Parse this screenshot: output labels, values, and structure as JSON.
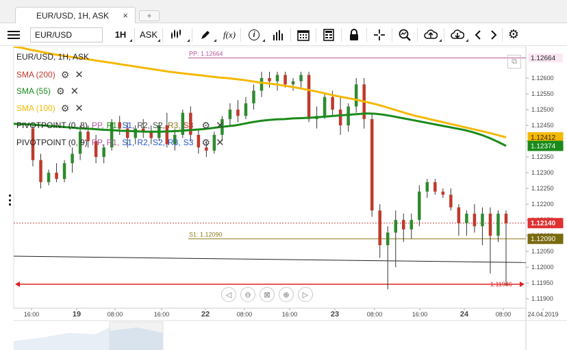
{
  "tab": {
    "label": "EUR/USD, 1H, ASK",
    "close": "×",
    "add": "+"
  },
  "toolbar": {
    "symbol": "EUR/USD",
    "timeframe": "1H",
    "side": "ASK",
    "fx_label": "f(x)",
    "info_label": "i",
    "icons": [
      "menu-icon",
      "candles-icon",
      "pencil-icon",
      "fx-icon",
      "info-icon",
      "bars-icon",
      "calendar-icon",
      "sheet-icon",
      "lock-icon",
      "crosshair-icon",
      "zoom-icon",
      "upload-icon",
      "download-icon",
      "prev-icon",
      "next-icon",
      "gear-icon"
    ]
  },
  "legend": {
    "title": "EUR/USD, 1H, ASK",
    "sma200": "SMA (200)",
    "sma55": "SMA (55)",
    "sma100": "SMA (100)",
    "pivot8": "PIVOTPOINT (0, 8)",
    "pivot9": "PIVOTPOINT (0, 9)",
    "pivot_parts": [
      "PP,",
      "R1,",
      "S1,",
      "R2,",
      "S2,",
      "R3,",
      "S3"
    ]
  },
  "levels": {
    "pp_label": "PP: 1.12664",
    "s1_label": "S1: 1.12090",
    "red_label": "1.11946"
  },
  "price_tags": {
    "pp": "1.12664",
    "sma100": "1.12412",
    "sma55": "1.12374",
    "current": "1.12140",
    "s1": "1.12090"
  },
  "yaxis": [
    "1.12600",
    "1.12550",
    "1.12500",
    "1.12450",
    "1.12400",
    "1.12350",
    "1.12300",
    "1.12250",
    "1.12200",
    "1.12150",
    "1.12100",
    "1.12050",
    "1.12000",
    "1.11950",
    "1.11900"
  ],
  "xaxis": [
    "16:00",
    "19",
    "08:00",
    "16:00",
    "22",
    "08:00",
    "16:00",
    "23",
    "08:00",
    "16:00",
    "24",
    "08:00",
    "24.04.2019"
  ],
  "colors": {
    "sma200": "#c0392b",
    "sma55": "#1a8a1a",
    "sma100": "#f5b800",
    "bull": "#2e8b2e",
    "bear": "#c0392b",
    "pp": "#b0559b",
    "s1": "#8a7a18",
    "red": "#e02020"
  },
  "chart_data": {
    "type": "candlestick",
    "title": "EUR/USD, 1H, ASK",
    "xlabel": "",
    "ylabel": "",
    "ylim": [
      1.1187,
      1.127
    ],
    "candles": [
      {
        "o": 1.1244,
        "h": 1.1246,
        "l": 1.1232,
        "c": 1.1234
      },
      {
        "o": 1.1234,
        "h": 1.1236,
        "l": 1.1225,
        "c": 1.1227
      },
      {
        "o": 1.1227,
        "h": 1.1231,
        "l": 1.1226,
        "c": 1.123
      },
      {
        "o": 1.123,
        "h": 1.1233,
        "l": 1.1227,
        "c": 1.1228
      },
      {
        "o": 1.1228,
        "h": 1.1234,
        "l": 1.1227,
        "c": 1.1233
      },
      {
        "o": 1.1233,
        "h": 1.1238,
        "l": 1.123,
        "c": 1.1236
      },
      {
        "o": 1.1236,
        "h": 1.1245,
        "l": 1.1234,
        "c": 1.1243
      },
      {
        "o": 1.1243,
        "h": 1.1245,
        "l": 1.1238,
        "c": 1.124
      },
      {
        "o": 1.124,
        "h": 1.1242,
        "l": 1.1233,
        "c": 1.1235
      },
      {
        "o": 1.1235,
        "h": 1.1239,
        "l": 1.1233,
        "c": 1.1238
      },
      {
        "o": 1.1238,
        "h": 1.1247,
        "l": 1.1237,
        "c": 1.1246
      },
      {
        "o": 1.1246,
        "h": 1.1248,
        "l": 1.1242,
        "c": 1.1244
      },
      {
        "o": 1.1244,
        "h": 1.1246,
        "l": 1.1238,
        "c": 1.1241
      },
      {
        "o": 1.1241,
        "h": 1.1245,
        "l": 1.1239,
        "c": 1.1244
      },
      {
        "o": 1.1244,
        "h": 1.1247,
        "l": 1.1241,
        "c": 1.1243
      },
      {
        "o": 1.1243,
        "h": 1.1245,
        "l": 1.1239,
        "c": 1.1241
      },
      {
        "o": 1.1241,
        "h": 1.1246,
        "l": 1.124,
        "c": 1.1245
      },
      {
        "o": 1.1245,
        "h": 1.1249,
        "l": 1.1238,
        "c": 1.1239
      },
      {
        "o": 1.1239,
        "h": 1.1244,
        "l": 1.1237,
        "c": 1.1242
      },
      {
        "o": 1.1242,
        "h": 1.125,
        "l": 1.1241,
        "c": 1.1249
      },
      {
        "o": 1.1249,
        "h": 1.1251,
        "l": 1.124,
        "c": 1.1242
      },
      {
        "o": 1.1242,
        "h": 1.1244,
        "l": 1.1236,
        "c": 1.1238
      },
      {
        "o": 1.1238,
        "h": 1.124,
        "l": 1.1235,
        "c": 1.1237
      },
      {
        "o": 1.1237,
        "h": 1.1243,
        "l": 1.1236,
        "c": 1.1242
      },
      {
        "o": 1.1242,
        "h": 1.1248,
        "l": 1.124,
        "c": 1.1247
      },
      {
        "o": 1.1247,
        "h": 1.1252,
        "l": 1.1245,
        "c": 1.125
      },
      {
        "o": 1.125,
        "h": 1.1253,
        "l": 1.1246,
        "c": 1.1248
      },
      {
        "o": 1.1248,
        "h": 1.1254,
        "l": 1.1247,
        "c": 1.1252
      },
      {
        "o": 1.1252,
        "h": 1.1258,
        "l": 1.125,
        "c": 1.1256
      },
      {
        "o": 1.1256,
        "h": 1.1262,
        "l": 1.1254,
        "c": 1.126
      },
      {
        "o": 1.126,
        "h": 1.1262,
        "l": 1.1257,
        "c": 1.1259
      },
      {
        "o": 1.1259,
        "h": 1.1262,
        "l": 1.1256,
        "c": 1.1261
      },
      {
        "o": 1.1261,
        "h": 1.1262,
        "l": 1.1257,
        "c": 1.1258
      },
      {
        "o": 1.1258,
        "h": 1.126,
        "l": 1.1256,
        "c": 1.1259
      },
      {
        "o": 1.1259,
        "h": 1.1262,
        "l": 1.1257,
        "c": 1.1261
      },
      {
        "o": 1.1261,
        "h": 1.1262,
        "l": 1.1246,
        "c": 1.1247
      },
      {
        "o": 1.1247,
        "h": 1.1251,
        "l": 1.1244,
        "c": 1.1248
      },
      {
        "o": 1.1248,
        "h": 1.1255,
        "l": 1.1247,
        "c": 1.1254
      },
      {
        "o": 1.1254,
        "h": 1.1256,
        "l": 1.1248,
        "c": 1.125
      },
      {
        "o": 1.125,
        "h": 1.1254,
        "l": 1.1242,
        "c": 1.1245
      },
      {
        "o": 1.1245,
        "h": 1.1252,
        "l": 1.1243,
        "c": 1.1251
      },
      {
        "o": 1.1251,
        "h": 1.126,
        "l": 1.1249,
        "c": 1.1258
      },
      {
        "o": 1.1258,
        "h": 1.126,
        "l": 1.1244,
        "c": 1.1247
      },
      {
        "o": 1.1247,
        "h": 1.1249,
        "l": 1.1216,
        "c": 1.1218
      },
      {
        "o": 1.1218,
        "h": 1.122,
        "l": 1.1203,
        "c": 1.1207
      },
      {
        "o": 1.1207,
        "h": 1.1213,
        "l": 1.1193,
        "c": 1.1211
      },
      {
        "o": 1.1211,
        "h": 1.1218,
        "l": 1.12,
        "c": 1.1215
      },
      {
        "o": 1.1215,
        "h": 1.1217,
        "l": 1.1208,
        "c": 1.1212
      },
      {
        "o": 1.1212,
        "h": 1.1217,
        "l": 1.1209,
        "c": 1.1215
      },
      {
        "o": 1.1215,
        "h": 1.1226,
        "l": 1.1213,
        "c": 1.1224
      },
      {
        "o": 1.1224,
        "h": 1.1228,
        "l": 1.1222,
        "c": 1.1227
      },
      {
        "o": 1.1227,
        "h": 1.1228,
        "l": 1.1223,
        "c": 1.1224
      },
      {
        "o": 1.1224,
        "h": 1.1225,
        "l": 1.1222,
        "c": 1.1223
      },
      {
        "o": 1.1223,
        "h": 1.1225,
        "l": 1.1218,
        "c": 1.1219
      },
      {
        "o": 1.1219,
        "h": 1.122,
        "l": 1.121,
        "c": 1.1214
      },
      {
        "o": 1.1214,
        "h": 1.1218,
        "l": 1.121,
        "c": 1.1217
      },
      {
        "o": 1.1217,
        "h": 1.122,
        "l": 1.1211,
        "c": 1.1213
      },
      {
        "o": 1.1213,
        "h": 1.1219,
        "l": 1.1207,
        "c": 1.1217
      },
      {
        "o": 1.1217,
        "h": 1.1219,
        "l": 1.1198,
        "c": 1.121
      },
      {
        "o": 1.121,
        "h": 1.1218,
        "l": 1.1208,
        "c": 1.1217
      },
      {
        "o": 1.1217,
        "h": 1.1218,
        "l": 1.1194,
        "c": 1.1214
      }
    ],
    "sma55": [
      1.12455,
      1.12454,
      1.12453,
      1.12451,
      1.12449,
      1.12447,
      1.12445,
      1.12443,
      1.12441,
      1.1244,
      1.12438,
      1.12436,
      1.12435,
      1.12433,
      1.12432,
      1.12431,
      1.1243,
      1.1243,
      1.1243,
      1.12431,
      1.12432,
      1.12434,
      1.12436,
      1.12438,
      1.12441,
      1.12444,
      1.12447,
      1.1245,
      1.12455,
      1.1246,
      1.12464,
      1.12467,
      1.12469,
      1.1247,
      1.12472,
      1.12473,
      1.12474,
      1.12476,
      1.12478,
      1.1248,
      1.12482,
      1.12484,
      1.12486,
      1.12488,
      1.12487,
      1.12484,
      1.1248,
      1.12475,
      1.1247,
      1.12465,
      1.1246,
      1.12455,
      1.1245,
      1.12445,
      1.1244,
      1.12435,
      1.12428,
      1.1242,
      1.1241,
      1.12398,
      1.12385
    ],
    "sma100": [
      1.127,
      1.12696,
      1.1269,
      1.12685,
      1.1268,
      1.12675,
      1.12671,
      1.12667,
      1.12664,
      1.1266,
      1.12656,
      1.12652,
      1.12648,
      1.12644,
      1.1264,
      1.12636,
      1.12632,
      1.12628,
      1.12624,
      1.1262,
      1.12617,
      1.12614,
      1.12611,
      1.12608,
      1.12605,
      1.12602,
      1.126,
      1.12597,
      1.12594,
      1.1259,
      1.12586,
      1.12583,
      1.1258,
      1.12576,
      1.12572,
      1.12567,
      1.12562,
      1.12557,
      1.12551,
      1.12545,
      1.1254,
      1.12535,
      1.1253,
      1.12524,
      1.12518,
      1.12511,
      1.12503,
      1.12495,
      1.12487,
      1.1248,
      1.12474,
      1.12468,
      1.12462,
      1.12456,
      1.1245,
      1.12444,
      1.12438,
      1.12432,
      1.12426,
      1.12419,
      1.12412
    ],
    "sma200_line": [
      1.12035,
      1.12015
    ],
    "levels": {
      "pp": 1.12664,
      "s1": 1.1209,
      "current": 1.1214,
      "red": 1.11946
    }
  }
}
